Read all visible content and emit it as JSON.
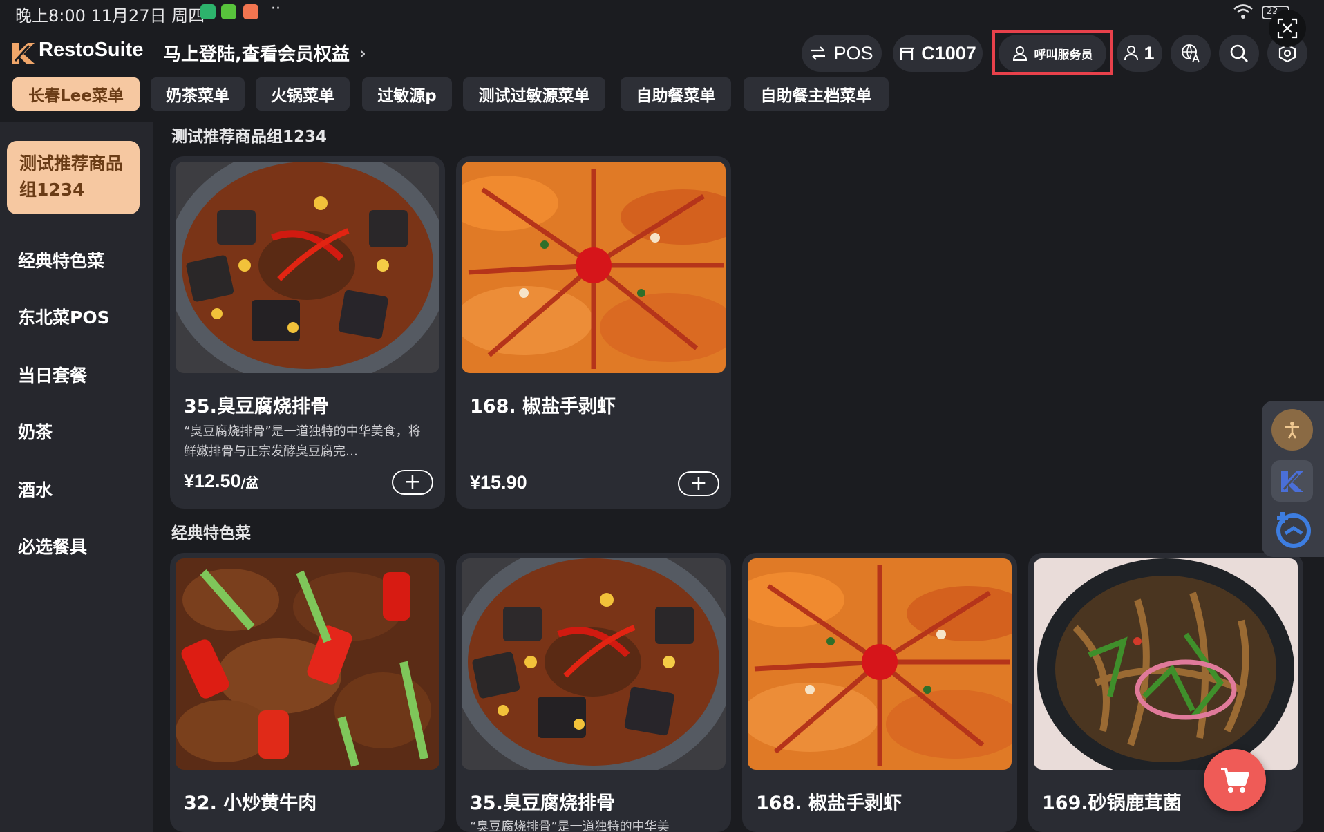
{
  "status_bar": {
    "time": "晚上8:00 11月27日 周四",
    "battery": "22",
    "more": "··"
  },
  "header": {
    "brand": "RestoSuite",
    "login_prompt": "马上登陆,查看会员权益",
    "pos_label": "POS",
    "table_label": "C1007",
    "call_waiter_label": "呼叫服务员",
    "guest_count": "1"
  },
  "menu_tabs": [
    {
      "label": "长春Lee菜单",
      "active": true
    },
    {
      "label": "奶茶菜单"
    },
    {
      "label": "火锅菜单"
    },
    {
      "label": "过敏源p"
    },
    {
      "label": "测试过敏源菜单"
    },
    {
      "label": "自助餐菜单"
    },
    {
      "label": "自助餐主档菜单"
    }
  ],
  "sidebar": {
    "items": [
      {
        "label": "测试推荐商品组1234",
        "active": true
      },
      {
        "label": "经典特色菜"
      },
      {
        "label": "东北菜POS"
      },
      {
        "label": "当日套餐"
      },
      {
        "label": "奶茶"
      },
      {
        "label": "酒水"
      },
      {
        "label": "必选餐具"
      }
    ]
  },
  "sections": [
    {
      "title": "测试推荐商品组1234",
      "items": [
        {
          "name": "35.臭豆腐烧排骨",
          "desc": "“臭豆腐烧排骨”是一道独特的中华美食，将鲜嫩排骨与正宗发酵臭豆腐完…",
          "price": "¥12.50",
          "unit": "/盆",
          "image": "stew-pot"
        },
        {
          "name": "168. 椒盐手剥虾",
          "desc": "",
          "price": "¥15.90",
          "unit": "",
          "image": "fried-shrimp"
        }
      ]
    },
    {
      "title": "经典特色菜",
      "items": [
        {
          "name": "32. 小炒黄牛肉",
          "image": "stir-fry-beef"
        },
        {
          "name": "35.臭豆腐烧排骨",
          "desc": "“臭豆腐烧排骨”是一道独特的中华美",
          "image": "stew-pot"
        },
        {
          "name": "168. 椒盐手剥虾",
          "image": "fried-shrimp"
        },
        {
          "name": "169.砂锅鹿茸菌",
          "image": "mushroom-claypot"
        }
      ]
    }
  ],
  "add_symbol": "+",
  "colors": {
    "background": "#1b1c20",
    "card": "#2a2c33",
    "accent_tab": "#f6c8a1",
    "accent_tab_text": "#6a3c16",
    "highlight_border": "#e8414b",
    "cart": "#ef5b57"
  },
  "icons": [
    "swap-icon",
    "table-icon",
    "service-bell-icon",
    "person-icon",
    "translate-icon",
    "search-icon",
    "settings-icon",
    "screenshot-icon",
    "accessibility-icon",
    "restosuite-icon",
    "screen-record-icon",
    "cart-icon"
  ]
}
